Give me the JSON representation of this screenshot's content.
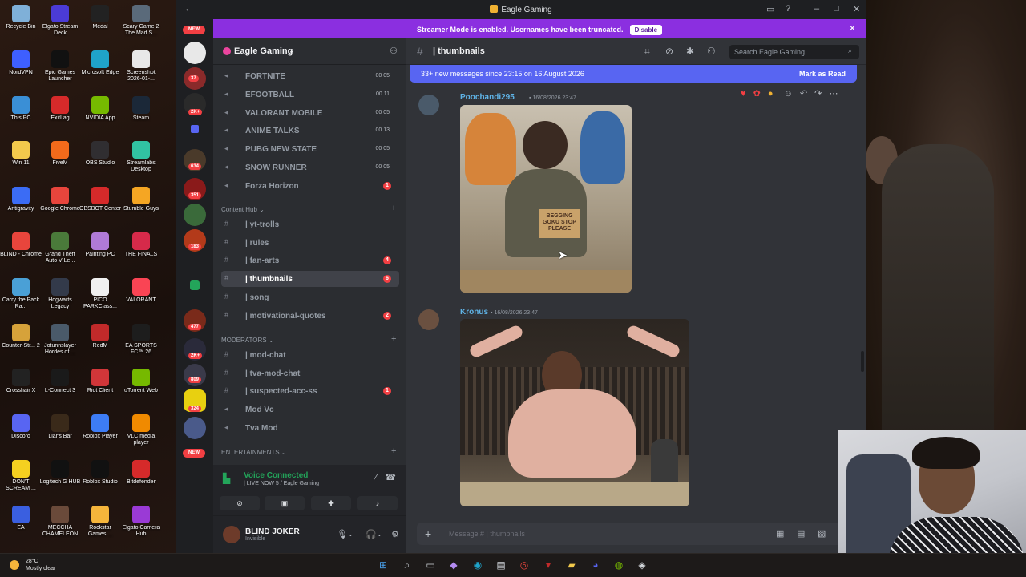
{
  "desktop": {
    "icons": [
      {
        "label": "Recycle Bin",
        "color": "#7fb0d8"
      },
      {
        "label": "Elgato Stream Deck",
        "color": "#4b3bd6"
      },
      {
        "label": "Medal",
        "color": "#222222"
      },
      {
        "label": "Scary Game 2 The Mad S...",
        "color": "#5a6a7a"
      },
      {
        "label": "NordVPN",
        "color": "#3e5fff"
      },
      {
        "label": "Epic Games Launcher",
        "color": "#111111"
      },
      {
        "label": "Microsoft Edge",
        "color": "#1fa3c9"
      },
      {
        "label": "Screenshot 2026-01-...",
        "color": "#e8e8e8"
      },
      {
        "label": "This PC",
        "color": "#3a8fd6"
      },
      {
        "label": "ExitLag",
        "color": "#d62a2a"
      },
      {
        "label": "NVIDIA App",
        "color": "#76b900"
      },
      {
        "label": "Steam",
        "color": "#1b2838"
      },
      {
        "label": "Win 11",
        "color": "#f2c94c"
      },
      {
        "label": "FiveM",
        "color": "#f26a1b"
      },
      {
        "label": "OBS Studio",
        "color": "#302e31"
      },
      {
        "label": "Streamlabs Desktop",
        "color": "#31c3a2"
      },
      {
        "label": "Antigravity",
        "color": "#3b6cf5"
      },
      {
        "label": "Google Chrome",
        "color": "#e8453c"
      },
      {
        "label": "OBSBOT Center",
        "color": "#d62a2a"
      },
      {
        "label": "Stumble Guys",
        "color": "#f5a623"
      },
      {
        "label": "BLIND - Chrome",
        "color": "#e8453c"
      },
      {
        "label": "Grand Theft Auto V Le...",
        "color": "#4a7a3a"
      },
      {
        "label": "Painting PC",
        "color": "#b07ad6"
      },
      {
        "label": "THE FINALS",
        "color": "#d62a4a"
      },
      {
        "label": "Carry the Pack Ra...",
        "color": "#4aa0d6"
      },
      {
        "label": "Hogwarts Legacy",
        "color": "#333a4a"
      },
      {
        "label": "PICO PARKClass...",
        "color": "#f0f0f0"
      },
      {
        "label": "VALORANT",
        "color": "#fa4454"
      },
      {
        "label": "Counter-Str... 2",
        "color": "#d6a23a"
      },
      {
        "label": "Jotunnslayer Hordes of ...",
        "color": "#4a5a6a"
      },
      {
        "label": "RedM",
        "color": "#c12a2a"
      },
      {
        "label": "EA SPORTS FC™ 26",
        "color": "#1d1d1d"
      },
      {
        "label": "Crosshair X",
        "color": "#222222"
      },
      {
        "label": "L-Connect 3",
        "color": "#1a1a1a"
      },
      {
        "label": "Riot Client",
        "color": "#d13639"
      },
      {
        "label": "uTorrent Web",
        "color": "#76b900"
      },
      {
        "label": "Discord",
        "color": "#5865f2"
      },
      {
        "label": "Liar's Bar",
        "color": "#3a2a1a"
      },
      {
        "label": "Roblox Player",
        "color": "#3d7cf5"
      },
      {
        "label": "VLC media player",
        "color": "#f08a00"
      },
      {
        "label": "DON'T SCREAM ...",
        "color": "#f5d020"
      },
      {
        "label": "Logitech G HUB",
        "color": "#111111"
      },
      {
        "label": "Roblox Studio",
        "color": "#111111"
      },
      {
        "label": "Bitdefender",
        "color": "#d62a2a"
      },
      {
        "label": "EA",
        "color": "#3a5fe0"
      },
      {
        "label": "MECCHA CHAMELEON",
        "color": "#6a4a3a"
      },
      {
        "label": "Rockstar Games ...",
        "color": "#f5b53b"
      },
      {
        "label": "Elgato Camera Hub",
        "color": "#9a3ad6"
      }
    ]
  },
  "window": {
    "title": "Eagle Gaming"
  },
  "streamer_banner": {
    "text": "Streamer Mode is enabled. Usernames have been truncated.",
    "button": "Disable"
  },
  "rail": {
    "new_top": "NEW",
    "new_bottom": "NEW",
    "badges": [
      "37",
      "2K+",
      "634",
      "351",
      "183",
      "477",
      "2K+",
      "809",
      "324"
    ]
  },
  "server": {
    "name": "Eagle Gaming",
    "voice_channels": [
      {
        "name": "FORTNITE",
        "count": "00 05"
      },
      {
        "name": "EFOOTBALL",
        "count": "00 11"
      },
      {
        "name": "VALORANT MOBILE",
        "count": "00 05"
      },
      {
        "name": "ANIME TALKS",
        "count": "00 13"
      },
      {
        "name": "PUBG NEW STATE",
        "count": "00 05"
      },
      {
        "name": "SNOW RUNNER",
        "count": "00 05"
      },
      {
        "name": "Forza Horizon",
        "count": "1"
      }
    ],
    "category_content": "Content Hub",
    "content_channels": [
      {
        "name": "| yt-trolls",
        "unread": ""
      },
      {
        "name": "| rules",
        "unread": ""
      },
      {
        "name": "| fan-arts",
        "unread": "4"
      },
      {
        "name": "| thumbnails",
        "unread": "6"
      },
      {
        "name": "| song",
        "unread": ""
      },
      {
        "name": "| motivational-quotes",
        "unread": "2"
      }
    ],
    "category_mod": "MODERATORS",
    "mod_channels": [
      {
        "name": "| mod-chat",
        "unread": ""
      },
      {
        "name": "| tva-mod-chat",
        "unread": ""
      },
      {
        "name": "| suspected-acc-ss",
        "unread": "1"
      },
      {
        "name": "Mod Vc",
        "unread": ""
      },
      {
        "name": "Tva Mod",
        "unread": ""
      }
    ],
    "category_ent": "ENTERTAINMENTS"
  },
  "voice_panel": {
    "status": "Voice Connected",
    "sub": "| LIVE NOW 5 / Eagle Gaming"
  },
  "user": {
    "name": "BLIND JOKER",
    "status": "Invisible"
  },
  "chat": {
    "channel": "thumbnails",
    "search_placeholder": "Search Eagle Gaming",
    "new_messages": "33+ new messages since 23:15 on 16 August 2026",
    "mark_as_read": "Mark as Read",
    "messages": [
      {
        "author": "Poochandi295",
        "time": "16/08/2026 23:47"
      },
      {
        "author": "Kronus",
        "time": "16/08/2026 23:47"
      }
    ],
    "image_text": "BEGGING GOKU STOP PLEASE",
    "composer_placeholder": "Message #  |  thumbnails"
  },
  "taskbar": {
    "temp": "28°C",
    "weather": "Mostly clear"
  }
}
